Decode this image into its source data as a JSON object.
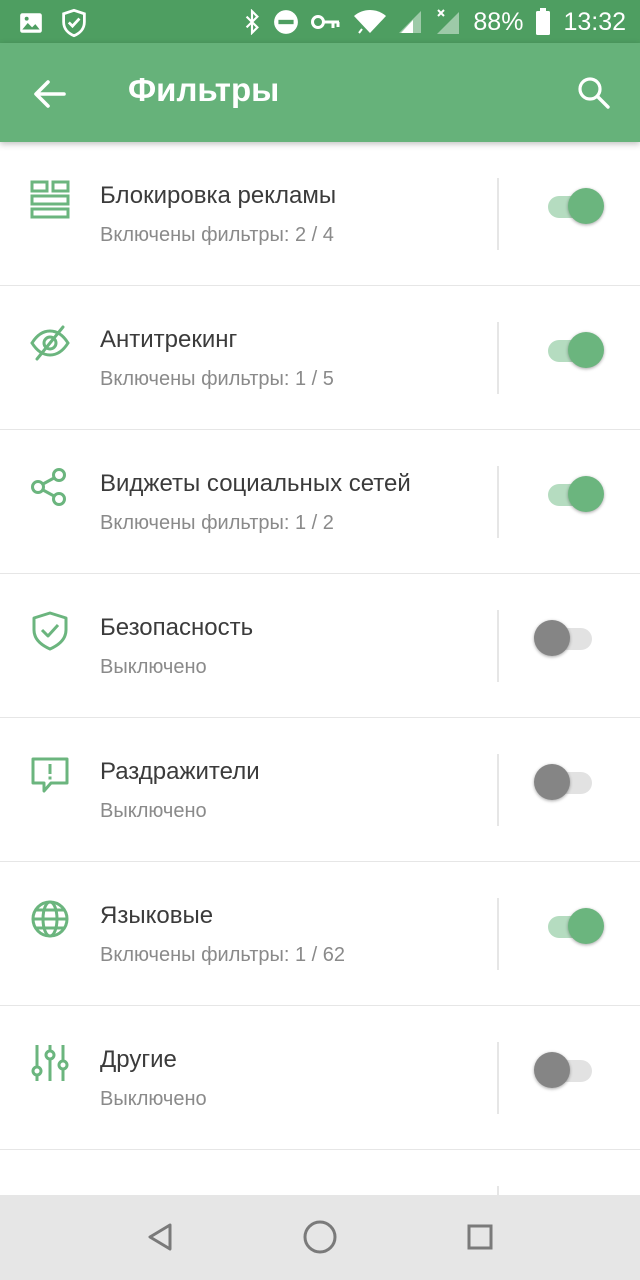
{
  "status_bar": {
    "battery": "88%",
    "time": "13:32",
    "icons": [
      "image-icon",
      "shield-check-icon",
      "bluetooth-icon",
      "do-not-disturb-icon",
      "vpn-key-icon",
      "wifi-icon",
      "signal-icon",
      "signal-x-icon",
      "battery-icon"
    ]
  },
  "app_bar": {
    "title": "Фильтры",
    "back_icon": "arrow-left-icon",
    "search_icon": "search-icon"
  },
  "filters": [
    {
      "title": "Блокировка рекламы",
      "subtitle": "Включены фильтры: 2 / 4",
      "icon": "ad-block-icon",
      "enabled": true
    },
    {
      "title": "Антитрекинг",
      "subtitle": "Включены фильтры: 1 / 5",
      "icon": "eye-off-icon",
      "enabled": true
    },
    {
      "title": "Виджеты социальных сетей",
      "subtitle": "Включены фильтры: 1 / 2",
      "icon": "share-icon",
      "enabled": true
    },
    {
      "title": "Безопасность",
      "subtitle": "Выключено",
      "icon": "shield-check-icon",
      "enabled": false
    },
    {
      "title": "Раздражители",
      "subtitle": "Выключено",
      "icon": "alert-message-icon",
      "enabled": false
    },
    {
      "title": "Языковые",
      "subtitle": "Включены фильтры: 1 / 62",
      "icon": "globe-icon",
      "enabled": true
    },
    {
      "title": "Другие",
      "subtitle": "Выключено",
      "icon": "sliders-icon",
      "enabled": false
    }
  ],
  "colors": {
    "status_bar": "#4e9e61",
    "app_bar": "#66b27a",
    "accent": "#6bb57e",
    "switch_off": "#858585"
  },
  "nav_bar": {
    "icons": [
      "back-triangle-icon",
      "home-circle-icon",
      "recents-square-icon"
    ]
  }
}
